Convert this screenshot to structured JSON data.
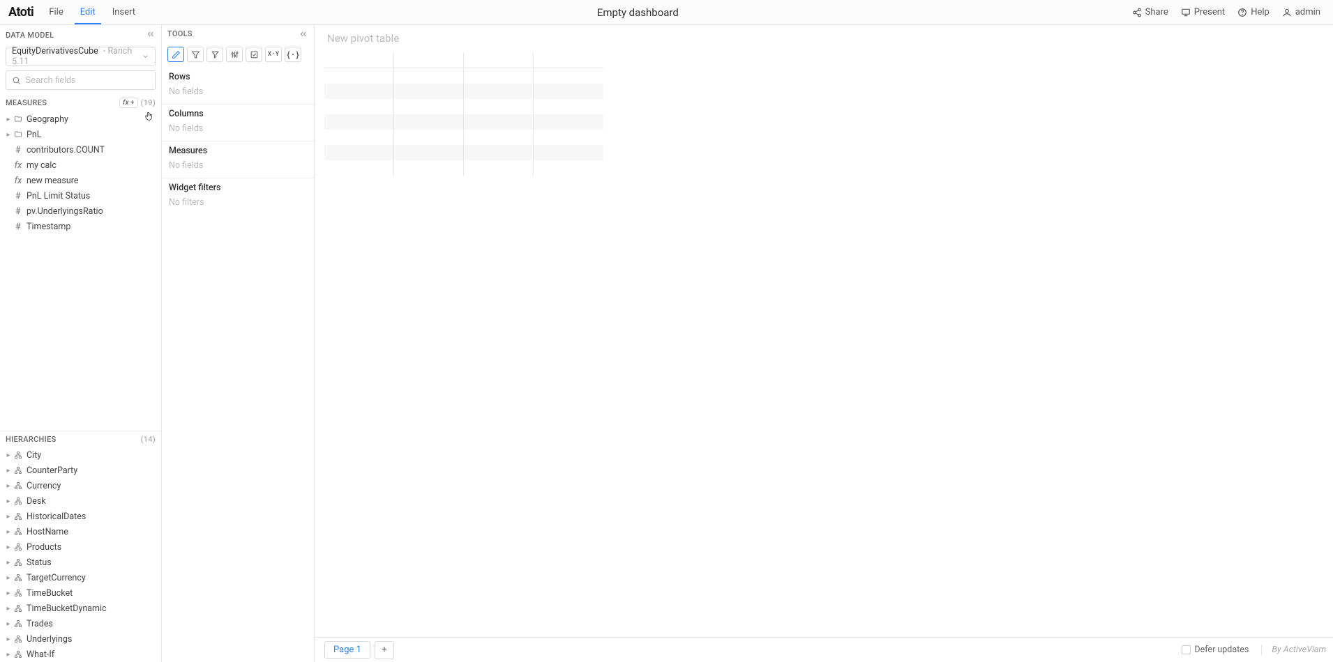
{
  "topbar": {
    "logo": "Atoti",
    "menu": {
      "file": "File",
      "edit": "Edit",
      "insert": "Insert"
    },
    "title": "Empty dashboard",
    "actions": {
      "share": "Share",
      "present": "Present",
      "help": "Help",
      "user": "admin"
    }
  },
  "sidebar": {
    "header": "DATA MODEL",
    "cube": {
      "name": "EquityDerivativesCube",
      "version": "Ranch 5.11"
    },
    "search_placeholder": "Search fields",
    "measures": {
      "label": "MEASURES",
      "count": "(19)",
      "fx_button": "fx",
      "items": [
        {
          "type": "folder",
          "name": "Geography"
        },
        {
          "type": "folder",
          "name": "PnL"
        },
        {
          "type": "hash",
          "name": "contributors.COUNT"
        },
        {
          "type": "fx",
          "name": "my calc"
        },
        {
          "type": "fx",
          "name": "new measure"
        },
        {
          "type": "hash",
          "name": "PnL Limit Status"
        },
        {
          "type": "hash",
          "name": "pv.UnderlyingsRatio"
        },
        {
          "type": "hash",
          "name": "Timestamp"
        }
      ]
    },
    "hierarchies": {
      "label": "HIERARCHIES",
      "count": "(14)",
      "items": [
        "City",
        "CounterParty",
        "Currency",
        "Desk",
        "HistoricalDates",
        "HostName",
        "Products",
        "Status",
        "TargetCurrency",
        "TimeBucket",
        "TimeBucketDynamic",
        "Trades",
        "Underlyings",
        "What-If"
      ]
    }
  },
  "tools": {
    "header": "TOOLS",
    "zones": {
      "rows": {
        "label": "Rows",
        "empty": "No fields"
      },
      "columns": {
        "label": "Columns",
        "empty": "No fields"
      },
      "measures": {
        "label": "Measures",
        "empty": "No fields"
      },
      "filters": {
        "label": "Widget filters",
        "empty": "No filters"
      }
    }
  },
  "canvas": {
    "title": "New pivot table"
  },
  "footer": {
    "page": "Page 1",
    "defer": "Defer updates",
    "branding": "By ActiveViam"
  }
}
